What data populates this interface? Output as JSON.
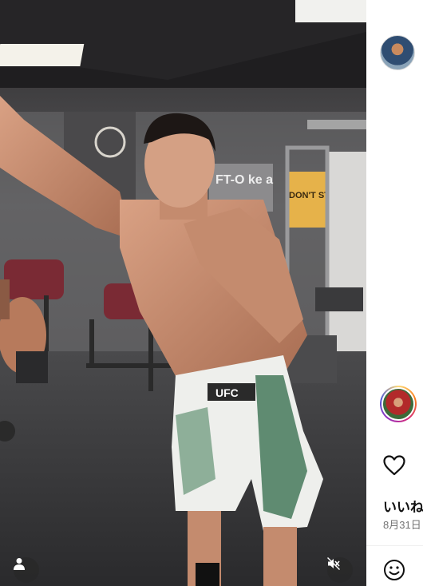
{
  "post": {
    "likes_label": "いいね",
    "date_label": "8月31日"
  },
  "media_scene": {
    "gym_sign_text": "FT-O ke a",
    "shorts_brand": "UFC",
    "poster_text": "DON'T STOP"
  },
  "icons": {
    "tagged_users": "user-icon",
    "mute": "muted-speaker-icon",
    "like": "heart-icon",
    "emoji": "smiley-icon"
  },
  "colors": {
    "story_ring": "#d62976",
    "date_text": "#737373",
    "media_button_bg": "#282828"
  }
}
